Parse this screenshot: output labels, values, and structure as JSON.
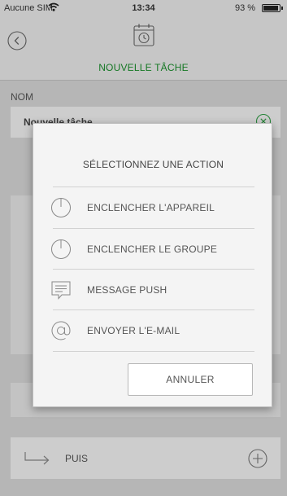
{
  "status_bar": {
    "carrier": "Aucune SIM",
    "time": "13:34",
    "battery": "93 %"
  },
  "header": {
    "title": "NOUVELLE TÂCHE",
    "back_icon": "chevron-left-circle-icon",
    "header_icon": "calendar-clock-icon",
    "accent_color": "#1a8f2c"
  },
  "form": {
    "name_label": "NOM",
    "name_value": "Nouvelle tâche",
    "then_label": "PUIS"
  },
  "dialog": {
    "title": "SÉLECTIONNEZ UNE ACTION",
    "actions": [
      {
        "label": "ENCLENCHER L'APPAREIL",
        "icon": "power-icon"
      },
      {
        "label": "ENCLENCHER LE GROUPE",
        "icon": "power-icon"
      },
      {
        "label": "MESSAGE PUSH",
        "icon": "message-icon"
      },
      {
        "label": "ENVOYER L'E-MAIL",
        "icon": "at-sign-icon"
      }
    ],
    "cancel_label": "ANNULER"
  }
}
